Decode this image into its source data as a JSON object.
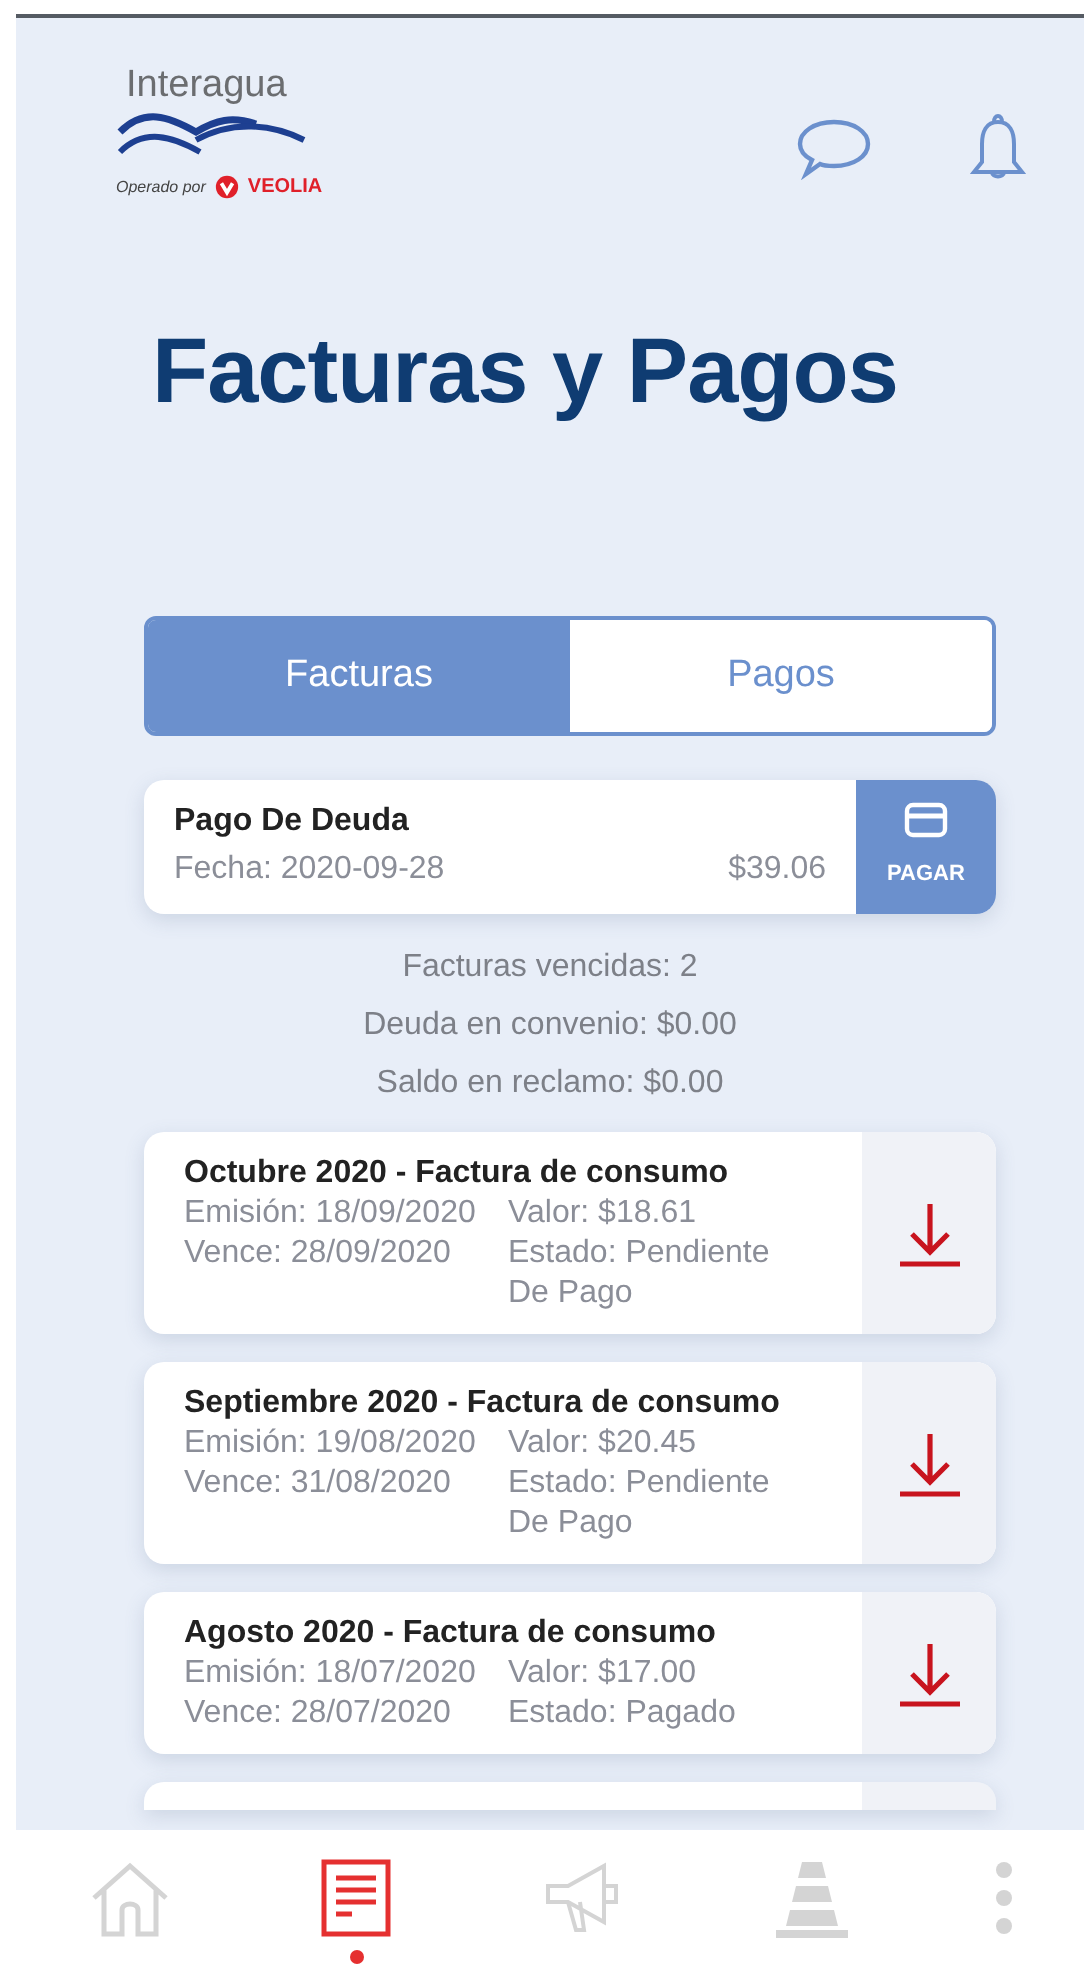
{
  "logo": {
    "brand": "Interagua",
    "operated_by": "Operado por",
    "operator": "VEOLIA"
  },
  "title": "Facturas y Pagos",
  "tabs": [
    {
      "label": "Facturas",
      "selected": true
    },
    {
      "label": "Pagos",
      "selected": false
    }
  ],
  "debt": {
    "title": "Pago De Deuda",
    "date": "Fecha: 2020-09-28",
    "amount": "$39.06",
    "button": "PAGAR"
  },
  "summary": [
    "Facturas vencidas: 2",
    "Deuda en convenio: $0.00",
    "Saldo en reclamo: $0.00"
  ],
  "invoices": [
    {
      "title": "Octubre 2020 - Factura de consumo",
      "issued": "Emisión: 18/09/2020",
      "value": "Valor: $18.61",
      "due": "Vence: 28/09/2020",
      "status": "Estado: Pendiente De Pago"
    },
    {
      "title": "Septiembre 2020 - Factura de consumo",
      "issued": "Emisión: 19/08/2020",
      "value": "Valor: $20.45",
      "due": "Vence: 31/08/2020",
      "status": "Estado: Pendiente De Pago"
    },
    {
      "title": "Agosto 2020 - Factura de consumo",
      "issued": "Emisión: 18/07/2020",
      "value": "Valor: $17.00",
      "due": "Vence: 28/07/2020",
      "status": "Estado: Pagado"
    }
  ],
  "nav": [
    {
      "kind": "home",
      "selected": false
    },
    {
      "kind": "bills",
      "selected": true
    },
    {
      "kind": "announce",
      "selected": false
    },
    {
      "kind": "cone",
      "selected": false
    },
    {
      "kind": "more",
      "selected": false
    }
  ]
}
